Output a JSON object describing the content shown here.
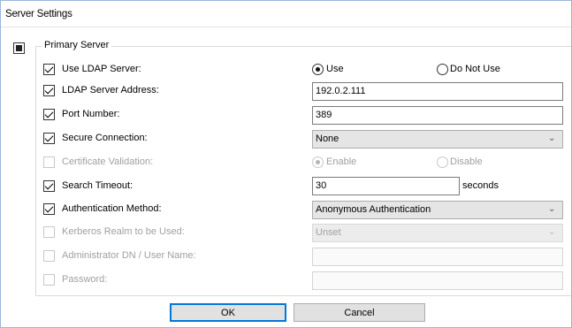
{
  "window": {
    "title": "Server Settings"
  },
  "section": {
    "label": "Primary Server"
  },
  "rows": {
    "use_ldap": {
      "label": "Use LDAP Server:",
      "checked": true,
      "enabled": true,
      "options": [
        "Use",
        "Do Not Use"
      ],
      "selected": "Use"
    },
    "address": {
      "label": "LDAP Server Address:",
      "checked": true,
      "enabled": true,
      "value": "192.0.2.111"
    },
    "port": {
      "label": "Port Number:",
      "checked": true,
      "enabled": true,
      "value": "389"
    },
    "secure": {
      "label": "Secure Connection:",
      "checked": true,
      "enabled": true,
      "value": "None"
    },
    "cert": {
      "label": "Certificate Validation:",
      "checked": false,
      "enabled": false,
      "options": [
        "Enable",
        "Disable"
      ],
      "selected": "Enable"
    },
    "timeout": {
      "label": "Search Timeout:",
      "checked": true,
      "enabled": true,
      "value": "30",
      "unit": "seconds"
    },
    "auth": {
      "label": "Authentication Method:",
      "checked": true,
      "enabled": true,
      "value": "Anonymous Authentication"
    },
    "kerberos": {
      "label": "Kerberos Realm to be Used:",
      "checked": false,
      "enabled": false,
      "value": "Unset"
    },
    "admin": {
      "label": "Administrator DN / User Name:",
      "checked": false,
      "enabled": false,
      "value": ""
    },
    "password": {
      "label": "Password:",
      "checked": false,
      "enabled": false,
      "value": ""
    }
  },
  "buttons": {
    "ok": "OK",
    "cancel": "Cancel"
  },
  "icons": {
    "checkbox": "check-icon",
    "dropdown": "chevron-down-icon",
    "section": "section-toggle-icon"
  },
  "colors": {
    "focus_border": "#0078d7",
    "disabled_text": "#a0a0a0",
    "window_border": "#9cb6d6"
  }
}
